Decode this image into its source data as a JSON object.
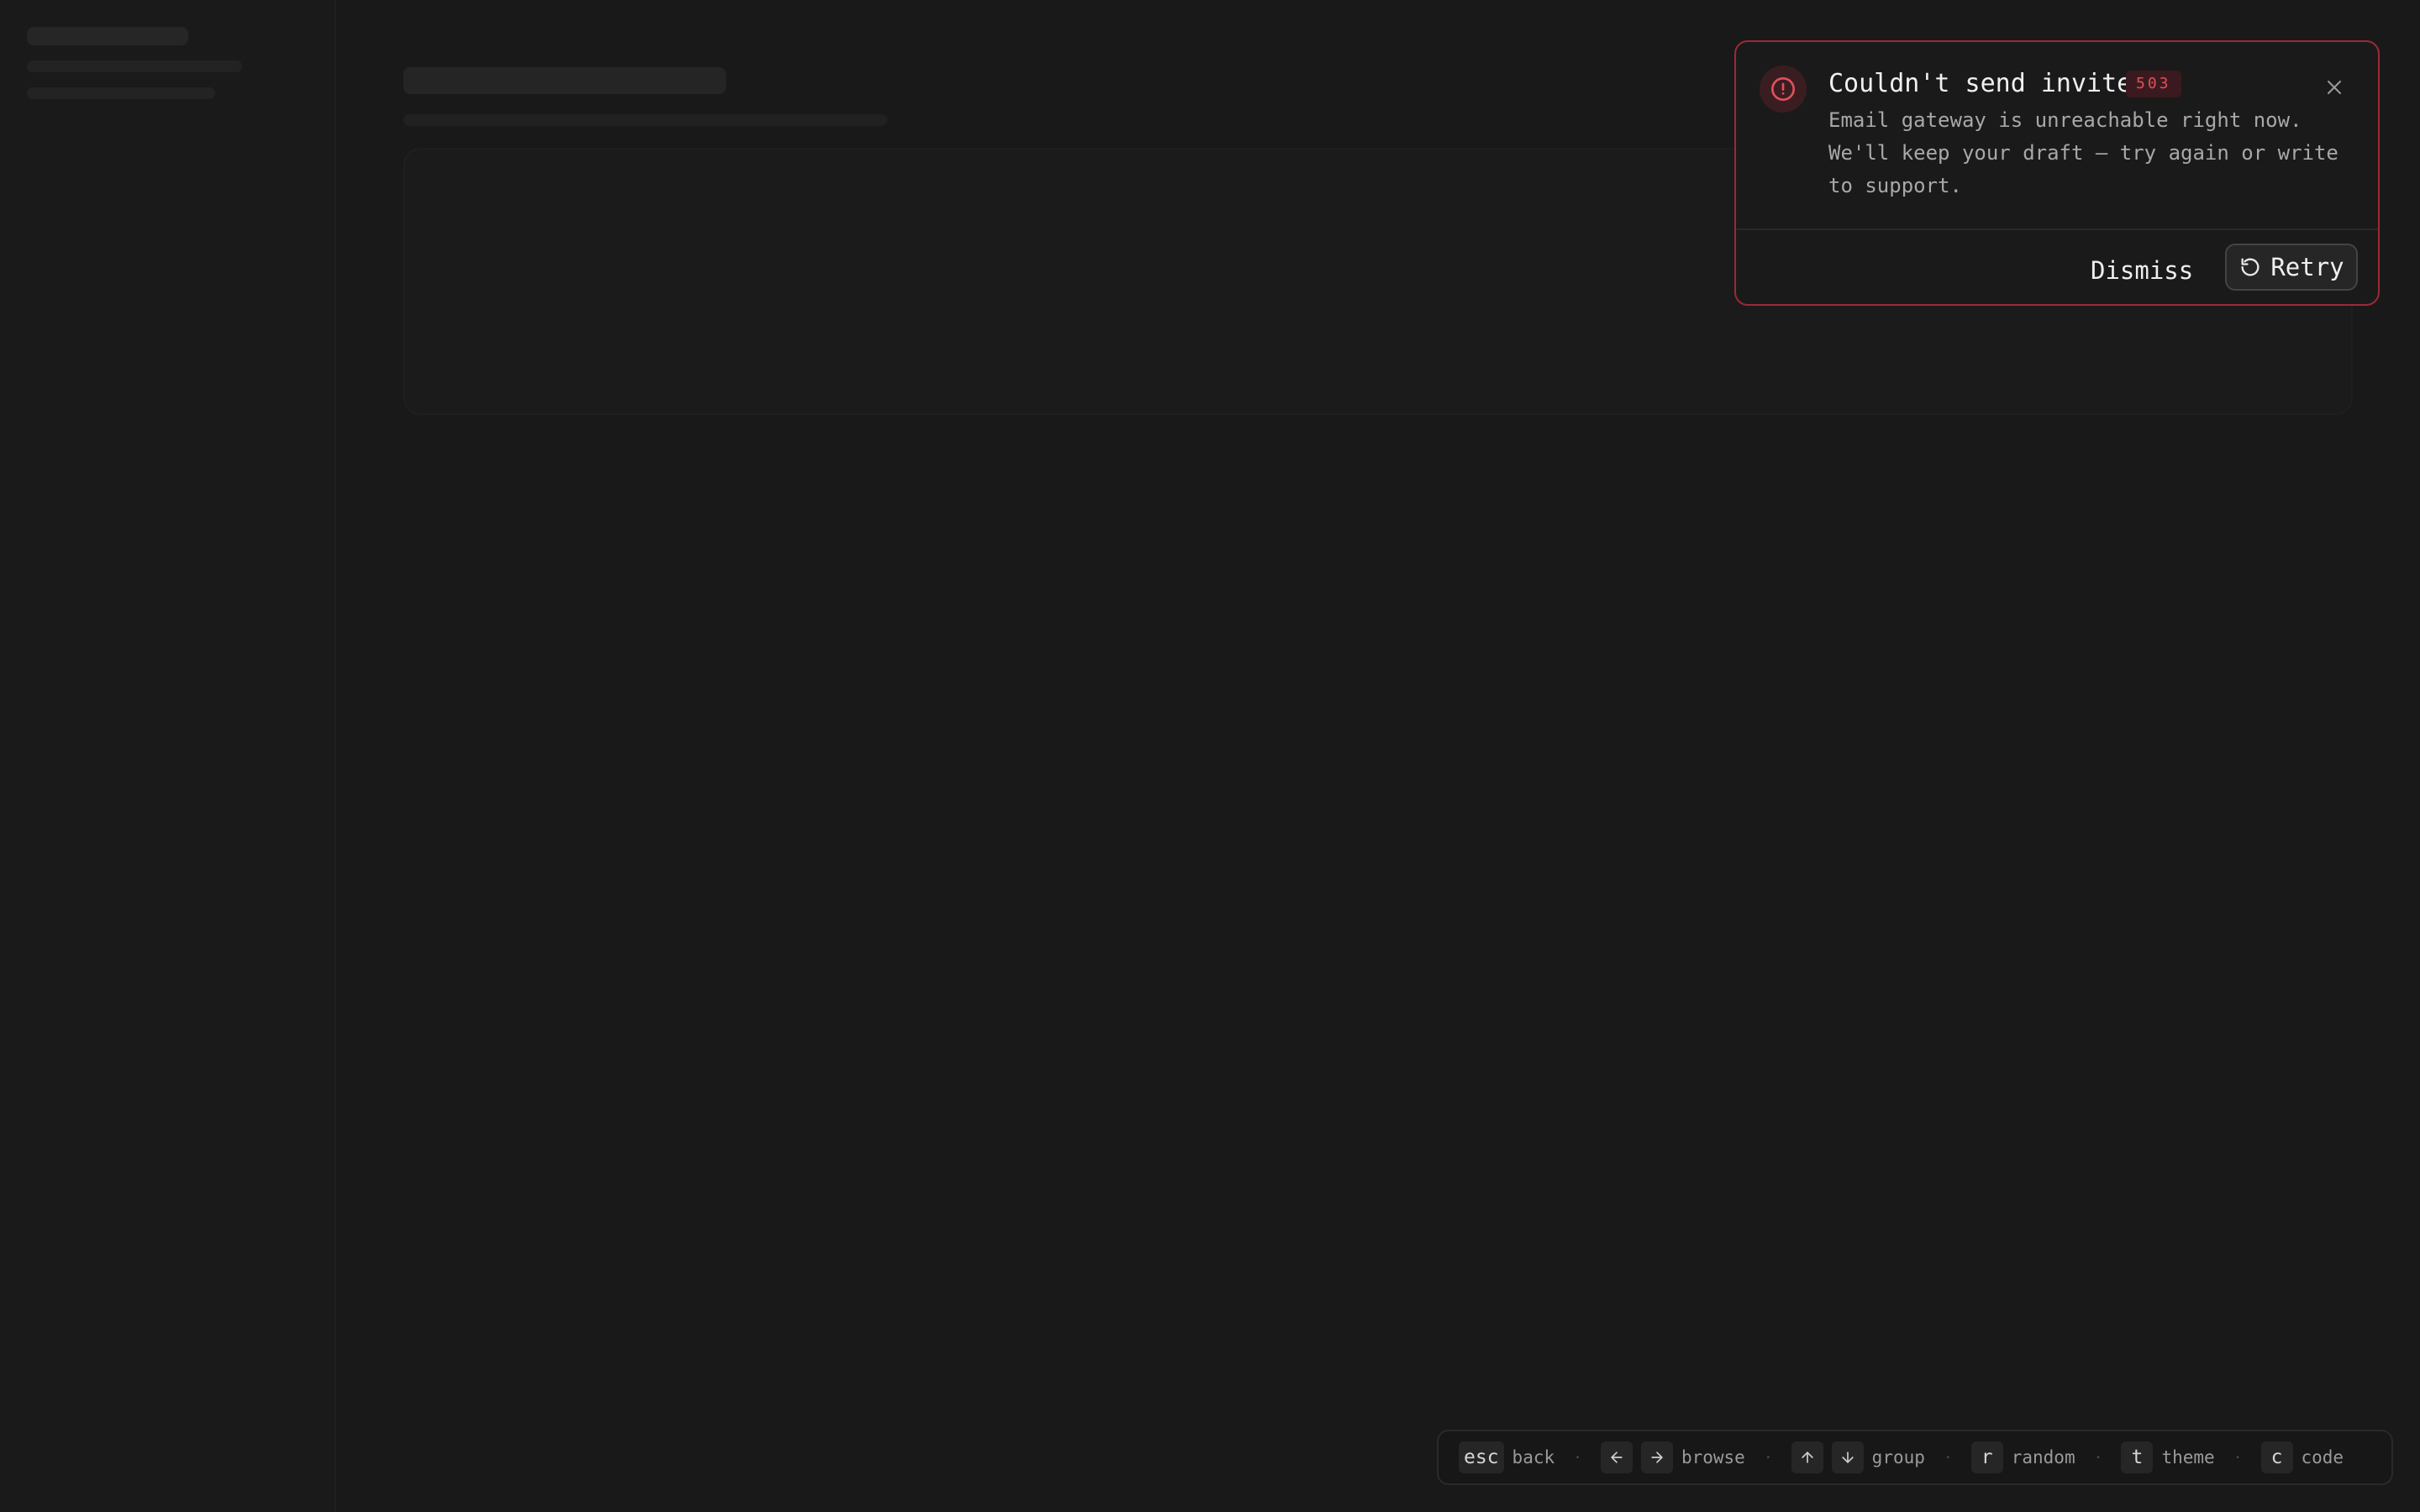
{
  "toast": {
    "title": "Couldn't send invite",
    "code": "503",
    "message": "Email gateway is unreachable right now. We'll keep your draft — try again or write to support.",
    "dismiss_label": "Dismiss",
    "retry_label": "Retry",
    "icons": {
      "alert": "alert-circle-icon",
      "close": "close-icon",
      "retry": "rotate-ccw-icon"
    },
    "colors": {
      "border": "#9b2a36",
      "accent": "#e0505c"
    }
  },
  "shortcuts": [
    {
      "keys": [
        "esc"
      ],
      "label": "back"
    },
    {
      "keys": [
        "←",
        "→"
      ],
      "label": "browse"
    },
    {
      "keys": [
        "↑",
        "↓"
      ],
      "label": "group"
    },
    {
      "keys": [
        "r"
      ],
      "label": "random"
    },
    {
      "keys": [
        "t"
      ],
      "label": "theme"
    },
    {
      "keys": [
        "c"
      ],
      "label": "code"
    }
  ],
  "separator": "·"
}
